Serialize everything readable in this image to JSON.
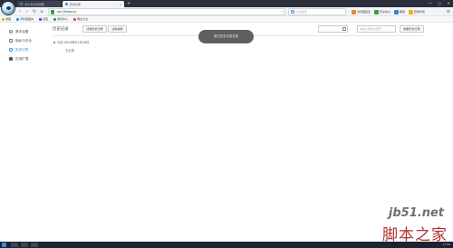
{
  "colors": {
    "accent": "#2e8ad8",
    "toast_bg": "#5e5f62",
    "taskbar": "#1b2430",
    "watermark_red": "#b03030"
  },
  "browser": {
    "tabs": [
      {
        "label": "360 安全浏览器",
        "active": false
      },
      {
        "label": "历史记录",
        "active": true
      }
    ],
    "new_tab_label": "+",
    "address": {
      "url": "se://history/"
    },
    "search_placeholder": "点此搜索",
    "toolbar": [
      {
        "label": "浏览器医生",
        "icon": "doctor-icon"
      },
      {
        "label": "安全中心",
        "icon": "shield-icon"
      },
      {
        "label": "翻译",
        "icon": "translate-icon"
      },
      {
        "label": "登录管家",
        "icon": "user-icon"
      }
    ],
    "bookmarks": [
      {
        "label": "收藏",
        "icon": "star-icon"
      },
      {
        "label": "手机收藏夹",
        "icon": "phone-icon"
      },
      {
        "label": "百度",
        "icon": "baidu-icon"
      },
      {
        "label": "游戏中心",
        "icon": "game-icon"
      },
      {
        "label": "网址大全",
        "icon": "sites-icon"
      }
    ],
    "window_controls": [
      "—",
      "▢",
      "✕"
    ]
  },
  "sidebar": {
    "items": [
      {
        "label": "基本设置",
        "icon": "settings-icon",
        "active": false
      },
      {
        "label": "隐私与安全",
        "icon": "lock-icon",
        "active": false
      },
      {
        "label": "历史记录",
        "icon": "history-icon",
        "active": true
      },
      {
        "label": "应用扩展",
        "icon": "grid-icon",
        "active": false
      }
    ]
  },
  "main": {
    "title": "历史记录",
    "clear_history_button": "清除历史记录",
    "clear_search_button": "清除搜索",
    "date_filter_value": "",
    "search_placeholder": "请输入搜索关键字",
    "search_history_button": "搜索历史记录",
    "groups": [
      {
        "date": "今天-2016年07月18日",
        "empty_text": "无记录"
      }
    ]
  },
  "toast": {
    "message": "清空历史记录完成"
  },
  "watermark": {
    "en": "jb51.net",
    "cn": "脚本之家"
  },
  "taskbar": {
    "tray": "17:06"
  }
}
